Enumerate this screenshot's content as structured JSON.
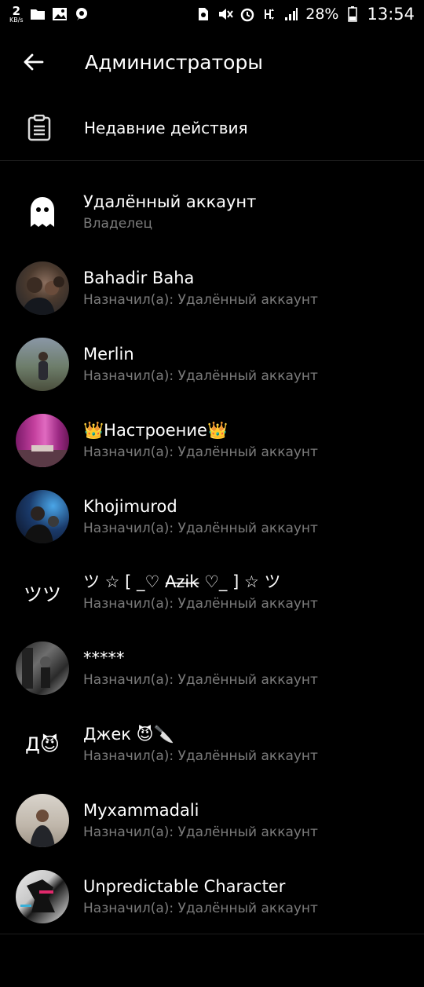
{
  "status_bar": {
    "speed_value": "2",
    "speed_unit": "KB/s",
    "battery_pct": "28%",
    "time": "13:54",
    "icons_left": [
      "folder-icon",
      "image-icon",
      "chat-icon"
    ],
    "icons_right": [
      "sim-icon",
      "mute-icon",
      "alarm-icon",
      "network-icon",
      "signal-icon",
      "battery-icon"
    ]
  },
  "app_bar": {
    "title": "Администраторы"
  },
  "recent_actions": {
    "label": "Недавние действия"
  },
  "admins": [
    {
      "name": "Удалённый аккаунт",
      "subtitle": "Владелец",
      "avatar": "ghost-icon"
    },
    {
      "name": "Bahadir Baha",
      "subtitle": "Назначил(а): Удалённый аккаунт",
      "avatar": "photo"
    },
    {
      "name": "Merlin",
      "subtitle": "Назначил(а): Удалённый аккаунт",
      "avatar": "photo"
    },
    {
      "name": "👑Настроение👑",
      "subtitle": "Назначил(а): Удалённый аккаунт",
      "avatar": "photo"
    },
    {
      "name": "Khojimurod",
      "subtitle": "Назначил(а): Удалённый аккаунт",
      "avatar": "photo"
    },
    {
      "name": "ツ ☆ [ _♡ A̶z̶i̶k̶ ♡_ ] ☆ ツ",
      "subtitle": "Назначил(а): Удалённый аккаунт",
      "avatar_text": "ツツ"
    },
    {
      "name": "*****",
      "subtitle": "Назначил(а): Удалённый аккаунт",
      "avatar": "photo"
    },
    {
      "name": "Джек 😈🔪",
      "subtitle": "Назначил(а): Удалённый аккаунт",
      "avatar_text": "Д😈"
    },
    {
      "name": "Myxammadali",
      "subtitle": "Назначил(а): Удалённый аккаунт",
      "avatar": "photo"
    },
    {
      "name": "Unpredictable Character",
      "subtitle": "Назначил(а): Удалённый аккаунт",
      "avatar": "photo"
    }
  ]
}
